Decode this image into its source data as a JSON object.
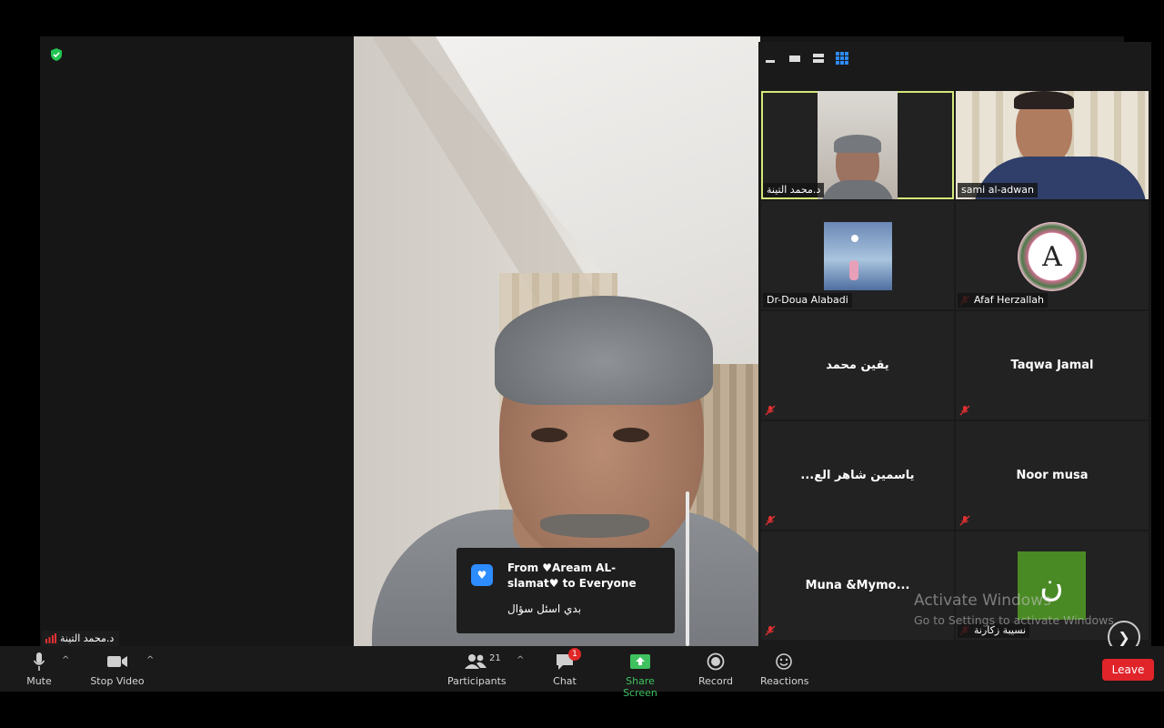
{
  "active_speaker": {
    "name": "د.محمد التينة"
  },
  "chat_notification": {
    "from": "From ♥Aream AL-slamat♥ to Everyone",
    "message": "بدي اسئل سؤال"
  },
  "gallery": {
    "tiles": [
      {
        "name": "د.محمد التينة",
        "muted": false,
        "active": true,
        "kind": "video"
      },
      {
        "name": "sami al-adwan",
        "muted": false,
        "active": false,
        "kind": "video"
      },
      {
        "name": "Dr-Doua Alabadi",
        "muted": false,
        "active": false,
        "kind": "picture"
      },
      {
        "name": "Afaf Herzallah",
        "muted": true,
        "active": false,
        "kind": "picture",
        "avatar_letter": "A"
      },
      {
        "name": "",
        "display_name": "يقين محمد",
        "muted": true,
        "kind": "name"
      },
      {
        "name": "",
        "display_name": "Taqwa  Jamal",
        "muted": true,
        "kind": "name"
      },
      {
        "name": "",
        "display_name": "...ياسمين شاهر الع",
        "muted": true,
        "kind": "name"
      },
      {
        "name": "",
        "display_name": "Noor musa",
        "muted": true,
        "kind": "name"
      },
      {
        "name": "",
        "display_name": "Muna  &Mymo...",
        "muted": true,
        "kind": "name"
      },
      {
        "name": "نسيبة زكارنة",
        "muted": true,
        "kind": "letter",
        "avatar_letter": "ن"
      }
    ]
  },
  "watermark": {
    "line1": "Activate Windows",
    "line2": "Go to Settings to activate Windows."
  },
  "toolbar": {
    "mute": "Mute",
    "stop_video": "Stop Video",
    "participants": "Participants",
    "participants_count": "21",
    "chat": "Chat",
    "chat_unread": "1",
    "share_screen": "Share Screen",
    "record": "Record",
    "reactions": "Reactions",
    "leave": "Leave"
  },
  "colors": {
    "share_green": "#3ec15e",
    "leave_red": "#e0242a",
    "active_outline": "#d3e87a",
    "chat_blue": "#2d8cff"
  }
}
